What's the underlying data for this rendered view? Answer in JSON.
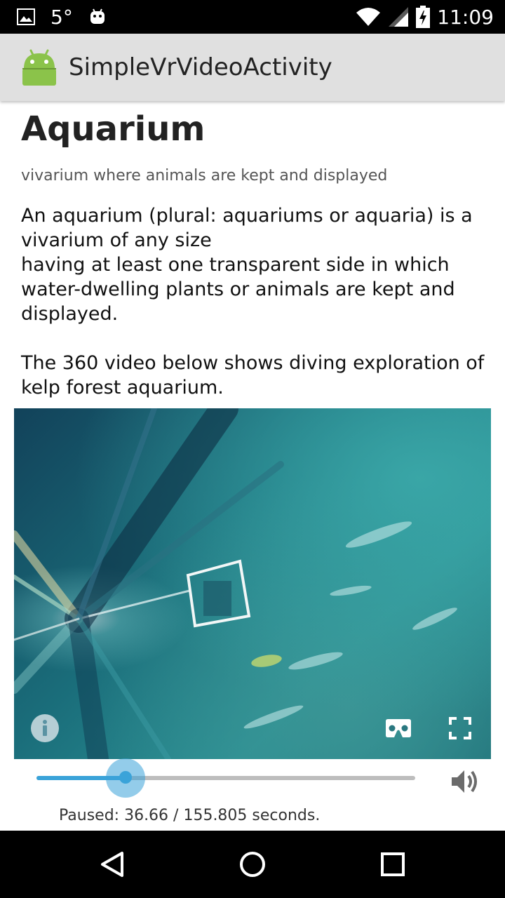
{
  "status_bar": {
    "temperature": "5°",
    "time": "11:09",
    "icons": [
      "image-notification-icon",
      "android-notification-icon",
      "wifi-icon",
      "signal-icon",
      "battery-charging-icon"
    ]
  },
  "app_bar": {
    "title": "SimpleVrVideoActivity",
    "logo": "android-logo-icon"
  },
  "article": {
    "title": "Aquarium",
    "subtitle": "vivarium where animals are kept and displayed",
    "paragraph1_line1": "An aquarium (plural: aquariums or aquaria) is a vivarium of any size",
    "paragraph1_line2": "having at least one transparent side in which water-dwelling plants or animals are kept and displayed.",
    "paragraph2": "The 360 video below shows diving exploration of kelp forest aquarium."
  },
  "video": {
    "controls": [
      "info-icon",
      "cardboard-vr-icon",
      "fullscreen-icon"
    ],
    "seek_progress": 0.235,
    "status": "Paused: 36.66 / 155.805 seconds."
  },
  "colors": {
    "accent": "#3aa3d9",
    "app_bar_bg": "#e0e0e0",
    "status_bar_bg": "#000000"
  },
  "nav_bar": {
    "buttons": [
      "back-icon",
      "home-icon",
      "recents-icon"
    ]
  }
}
